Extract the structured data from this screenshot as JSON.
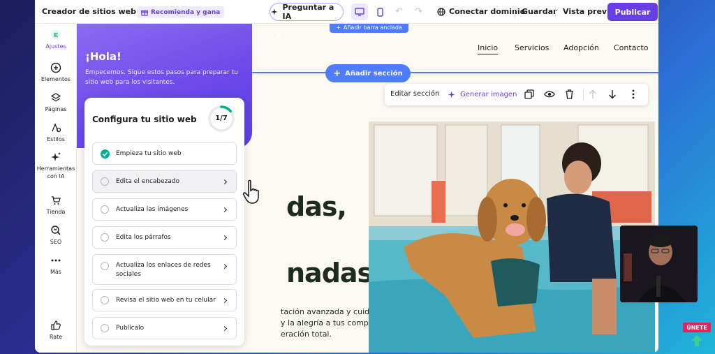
{
  "topbar": {
    "site_title": "Creador de sitios web",
    "recommend": "Recomienda y gana",
    "ask_ai": "Preguntar a IA",
    "connect_domain": "Conectar dominio",
    "save": "Guardar",
    "preview": "Vista previa",
    "publish": "Publicar"
  },
  "sidebar": {
    "items": [
      {
        "label": "Ajustes",
        "icon": "settings-logo-icon"
      },
      {
        "label": "Elementos",
        "icon": "plus-circle-icon"
      },
      {
        "label": "Páginas",
        "icon": "layers-icon"
      },
      {
        "label": "Estilos",
        "icon": "styles-icon"
      },
      {
        "label": "Herramientas con IA",
        "icon": "sparkle-icon"
      },
      {
        "label": "Tienda",
        "icon": "cart-icon"
      },
      {
        "label": "SEO",
        "icon": "seo-icon"
      },
      {
        "label": "Más",
        "icon": "more-icon"
      },
      {
        "label": "Rate",
        "icon": "thumbs-up-icon"
      }
    ]
  },
  "canvas": {
    "anchor_bar": "Añadir barra anclada",
    "nav": [
      "Inicio",
      "Servicios",
      "Adopción",
      "Contacto"
    ],
    "add_section": "Añadir sección",
    "edit_section": "Editar sección",
    "generate_image": "Generar imagen",
    "hero_line1": "das,",
    "hero_line2": "nadas",
    "hero_p1": "tación avanzada y cuidado",
    "hero_p2": "y la alegría a tus compañeros,",
    "hero_p3": "eración total."
  },
  "onboarding": {
    "greeting": "¡Hola!",
    "intro": "Empecemos. Sigue estos pasos para preparar tu sitio web para los visitantes.",
    "card_title": "Configura tu sitio web",
    "progress_text": "1/7",
    "progress_fraction": 0.143,
    "steps": [
      {
        "label": "Empieza tu sitio web",
        "done": true
      },
      {
        "label": "Edita el encabezado",
        "done": false
      },
      {
        "label": "Actualiza las imágenes",
        "done": false
      },
      {
        "label": "Edita los párrafos",
        "done": false
      },
      {
        "label": "Actualiza los enlaces de redes sociales",
        "done": false
      },
      {
        "label": "Revisa el sitio web en tu celular",
        "done": false
      },
      {
        "label": "Publícalo",
        "done": false
      }
    ]
  },
  "overlay": {
    "join": "ÚNETE"
  },
  "colors": {
    "accent": "#673de6",
    "editor_blue": "#4f7cff",
    "success": "#00b090"
  }
}
